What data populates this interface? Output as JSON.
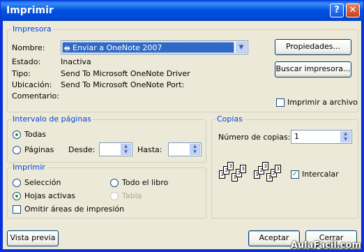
{
  "window": {
    "title": "Imprimir"
  },
  "printer": {
    "group_label": "Impresora",
    "name_label": "Nombre:",
    "name_value": "Enviar a OneNote 2007",
    "status_label": "Estado:",
    "status_value": "Inactiva",
    "type_label": "Tipo:",
    "type_value": "Send To Microsoft OneNote Driver",
    "location_label": "Ubicación:",
    "location_value": "Send To Microsoft OneNote Port:",
    "comment_label": "Comentario:",
    "properties_button": "Propiedades...",
    "find_button": "Buscar impresora...",
    "print_to_file": "Imprimir a archivo"
  },
  "range": {
    "group_label": "Intervalo de páginas",
    "all": "Todas",
    "pages": "Páginas",
    "from_label": "Desde:",
    "to_label": "Hasta:"
  },
  "print_what": {
    "group_label": "Imprimir",
    "selection": "Selección",
    "workbook": "Todo el libro",
    "active_sheets": "Hojas activas",
    "table": "Tabla",
    "ignore_areas": "Omitir áreas de impresión"
  },
  "copies": {
    "group_label": "Copias",
    "count_label": "Número de copias:",
    "count_value": "1",
    "collate": "Intercalar"
  },
  "footer": {
    "preview_button": "Vista previa",
    "ok_button": "Aceptar",
    "cancel_button": "Cerrar"
  },
  "watermark": "AulaFacil.com",
  "icons": {
    "help": "help-icon",
    "close": "close-icon",
    "printer": "printer-icon"
  }
}
